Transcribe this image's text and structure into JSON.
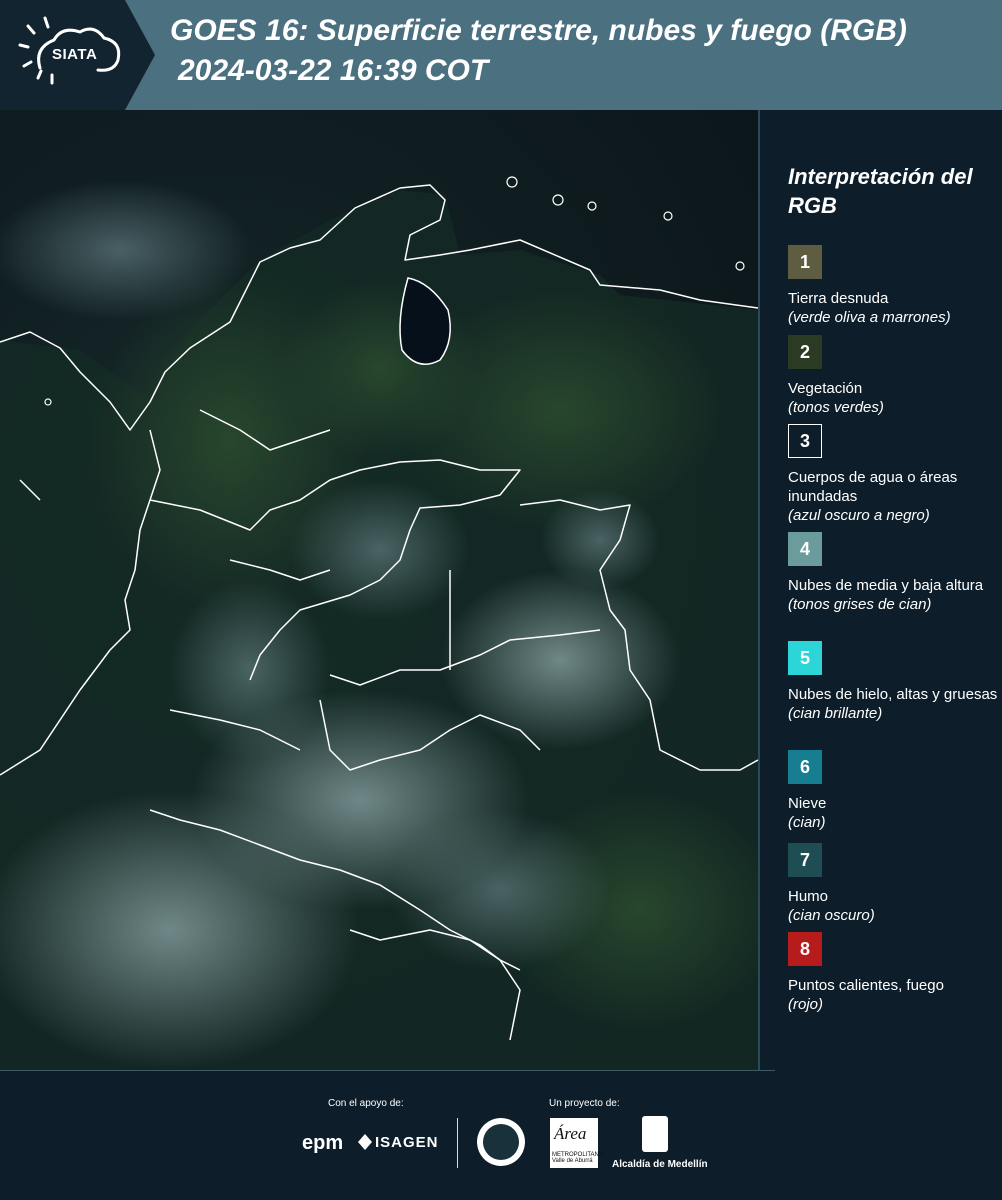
{
  "header": {
    "logo_text": "SIATA",
    "title_line1": "GOES 16: Superficie terrestre, nubes y fuego (RGB)",
    "title_line2": "2024-03-22 16:39 COT"
  },
  "legend": {
    "title": "Interpretación del RGB",
    "items": [
      {
        "num": "1",
        "label": "Tierra desnuda",
        "sub": "(verde oliva a marrones)",
        "color": "#5f5d41"
      },
      {
        "num": "2",
        "label": "Vegetación",
        "sub": "(tonos verdes)",
        "color": "#2b3b23"
      },
      {
        "num": "3",
        "label": "Cuerpos de agua o áreas inundadas",
        "sub": "(azul oscuro a negro)",
        "color": "#0d1e2a"
      },
      {
        "num": "4",
        "label": "Nubes de media y baja altura",
        "sub": "(tonos grises de cian)",
        "color": "#6c9b9c"
      },
      {
        "num": "5",
        "label": "Nubes de hielo, altas y gruesas",
        "sub": "(cian brillante)",
        "color": "#2cd6d8"
      },
      {
        "num": "6",
        "label": "Nieve",
        "sub": "(cian)",
        "color": "#177e92"
      },
      {
        "num": "7",
        "label": "Humo",
        "sub": "(cian oscuro)",
        "color": "#1e4e53"
      },
      {
        "num": "8",
        "label": "Puntos calientes, fuego",
        "sub": "(rojo)",
        "color": "#b71c1c"
      }
    ]
  },
  "footer": {
    "support_label": "Con el apoyo de:",
    "project_label": "Un proyecto de:",
    "epm": "epm",
    "isagen": "ISAGEN",
    "area_text": "Área",
    "area_sub": "METROPOLITANA Valle de Aburrá",
    "alcaldia": "Alcaldía de Medellín"
  }
}
